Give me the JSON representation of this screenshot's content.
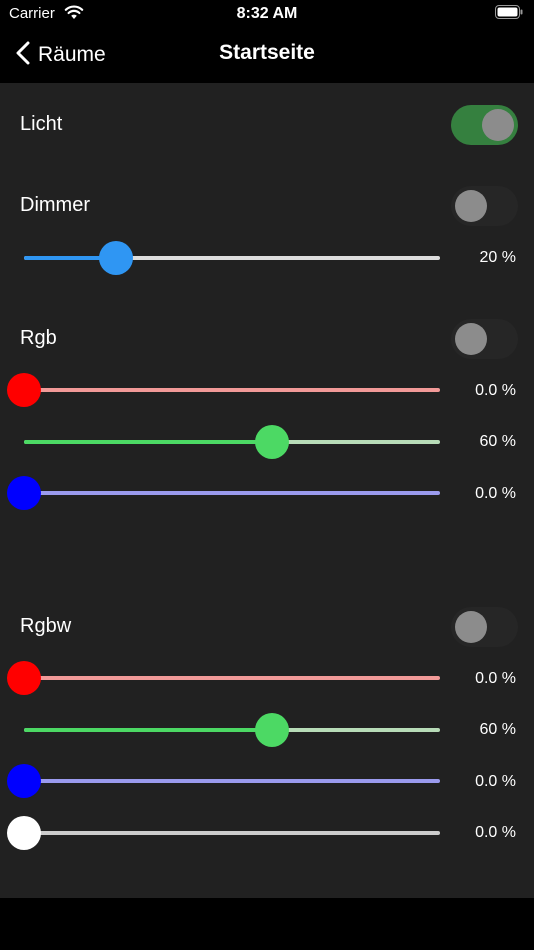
{
  "status": {
    "carrier": "Carrier",
    "time": "8:32 AM"
  },
  "nav": {
    "back_label": "Räume",
    "title": "Startseite"
  },
  "licht": {
    "label": "Licht",
    "on": true
  },
  "dimmer": {
    "label": "Dimmer",
    "on": false,
    "slider": {
      "fraction": 0.22,
      "value": "20 %",
      "thumb": "#2f96f3",
      "fill": "#2f96f3",
      "track": "#dddddd"
    }
  },
  "rgb": {
    "label": "Rgb",
    "on": false,
    "sliders": [
      {
        "name": "red",
        "fraction": 0.0,
        "value": "0.0 %",
        "thumb": "#ff0000",
        "fill": "#ff0000",
        "track": "#f29a98"
      },
      {
        "name": "green",
        "fraction": 0.595,
        "value": "60 %",
        "thumb": "#4cd964",
        "fill": "#4cd964",
        "track": "#b8dcb8"
      },
      {
        "name": "blue",
        "fraction": 0.0,
        "value": "0.0 %",
        "thumb": "#0000ff",
        "fill": "#0000ff",
        "track": "#9b9bee"
      }
    ]
  },
  "rgbw": {
    "label": "Rgbw",
    "on": false,
    "sliders": [
      {
        "name": "red",
        "fraction": 0.0,
        "value": "0.0 %",
        "thumb": "#ff0000",
        "fill": "#ff0000",
        "track": "#f29a98"
      },
      {
        "name": "green",
        "fraction": 0.595,
        "value": "60 %",
        "thumb": "#4cd964",
        "fill": "#4cd964",
        "track": "#b8dcb8"
      },
      {
        "name": "blue",
        "fraction": 0.0,
        "value": "0.0 %",
        "thumb": "#0000ff",
        "fill": "#0000ff",
        "track": "#9b9bee"
      },
      {
        "name": "white",
        "fraction": 0.0,
        "value": "0.0 %",
        "thumb": "#ffffff",
        "fill": "#ffffff",
        "track": "#cccccc"
      }
    ]
  },
  "colors": {
    "toggle_on": "#35803f",
    "toggle_off": "#262626",
    "section_bg": "#212121"
  }
}
